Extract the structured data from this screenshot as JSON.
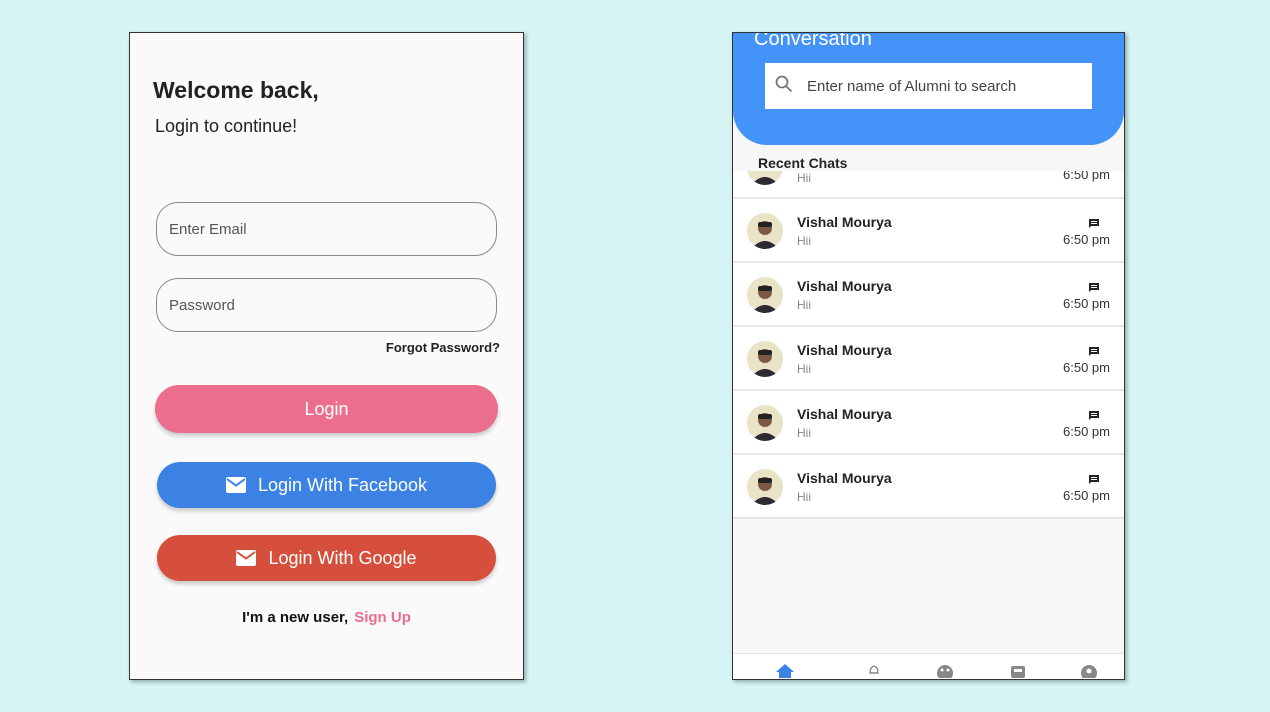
{
  "login": {
    "title": "Welcome back,",
    "subtitle": "Login to continue!",
    "email_placeholder": "Enter Email",
    "password_placeholder": "Password",
    "forgot_password": "Forgot Password?",
    "login_button": "Login",
    "facebook_button": "Login With Facebook",
    "google_button": "Login With Google",
    "new_user_text": "I'm a new user,",
    "signup_link": "Sign Up",
    "colors": {
      "login": "#ec6e8e",
      "facebook": "#3b82e4",
      "google": "#d64f3d"
    }
  },
  "chat": {
    "title": "Conversation",
    "search_placeholder": "Enter name of Alumni to search",
    "section_label": "Recent Chats",
    "header_color": "#4493f8",
    "partial_row": {
      "message": "Hii",
      "time": "6:50 pm"
    },
    "rows": [
      {
        "name": "Vishal Mourya",
        "message": "Hii",
        "time": "6:50 pm"
      },
      {
        "name": "Vishal Mourya",
        "message": "Hii",
        "time": "6:50 pm"
      },
      {
        "name": "Vishal Mourya",
        "message": "Hii",
        "time": "6:50 pm"
      },
      {
        "name": "Vishal Mourya",
        "message": "Hii",
        "time": "6:50 pm"
      },
      {
        "name": "Vishal Mourya",
        "message": "Hii",
        "time": "6:50 pm"
      }
    ],
    "nav_icons": [
      "home-icon",
      "notification-icon",
      "people-icon",
      "inbox-icon",
      "profile-icon"
    ]
  }
}
